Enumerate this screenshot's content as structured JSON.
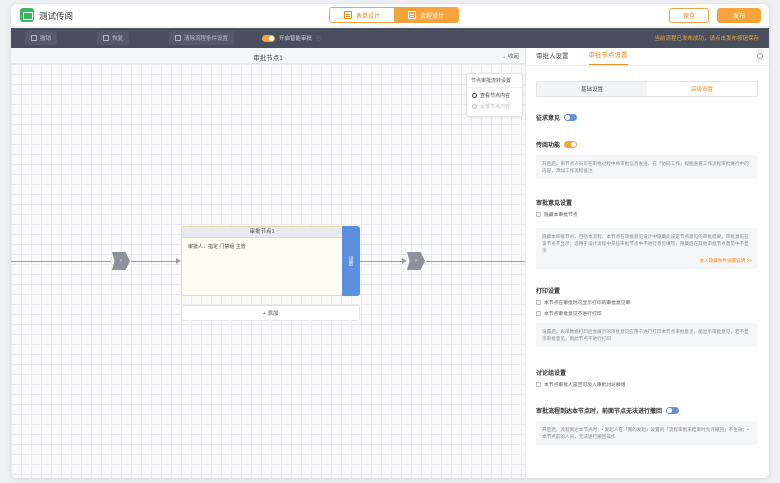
{
  "header": {
    "app_title": "测试传阅",
    "tabs": [
      {
        "label": "表单设计",
        "active": false
      },
      {
        "label": "流程设计",
        "active": true
      }
    ],
    "save_label": "保存",
    "publish_label": "发布"
  },
  "toolbar": {
    "undo_label": "撤销",
    "redo_label": "恢复",
    "reset_label": "清除流程条件设置",
    "toggle_label": "开启智能审批",
    "warning": "当前流程已发布成功，请点击发布按钮保存"
  },
  "canvas": {
    "title": "审批节点1",
    "collapse_label": "收起",
    "menu": {
      "header": "节点审批流转设置",
      "item1": "查看节点内容",
      "item2": "设置节点内容"
    },
    "node": {
      "title": "审批节点1",
      "body": "审批人：指定 门禁组 主管",
      "side_label": "设置",
      "add_label": "+ 添加"
    }
  },
  "panel": {
    "tabs": [
      {
        "label": "审批人设置",
        "active": false
      },
      {
        "label": "审批节点设置",
        "active": true
      }
    ],
    "subtabs": [
      {
        "label": "基础设置",
        "active": false
      },
      {
        "label": "高级设置",
        "active": true
      }
    ],
    "sec1_label": "征求意见",
    "sec2_label": "传阅功能",
    "sec2_desc": "开启后，审节点人员可在审批过程中将审批信息发送，在「协同工作」视图查看工作流程审批进行中的内容，添加工作流程备注",
    "sec3_label": "审批意见设置",
    "sec3_check": "隐藏本审批节点",
    "sec3_desc": "隐藏本审批节点，包括本流程、本节点在审批意见设计中隐藏此设定节点意见的审批结果，审批意见在该节点不显示；适用于设计流程中某些审批节点中不进行意见填写，隐藏后在其他审批节点意见中不显示",
    "sec3_link": "进入隐藏条件设置说明 >>",
    "sec4_label": "打印设置",
    "sec4_check1": "本节点在审批时可显示打印的审批意见审",
    "sec4_check2": "本节点审批意见不进行打印",
    "sec4_desc": "设置后，表单数据打印后会展示的审批意见应用于进行打印本节点审批意见，能显示审批意见，若不显示审批意见，则此节点不进行打印",
    "sec5_label": "讨论组设置",
    "sec5_check": "本节点审批人是否可加入审批讨论群组",
    "sec6_label": "审批流程到达本节点时，前面节点无法进行撤回",
    "sec6_desc": "开启后，流程到达本节点时：• 发起人在「我的发起」设置的「流程审批未结束时允许撤回」不生效；• 本节点前的人员，无法进行撤回操作"
  }
}
